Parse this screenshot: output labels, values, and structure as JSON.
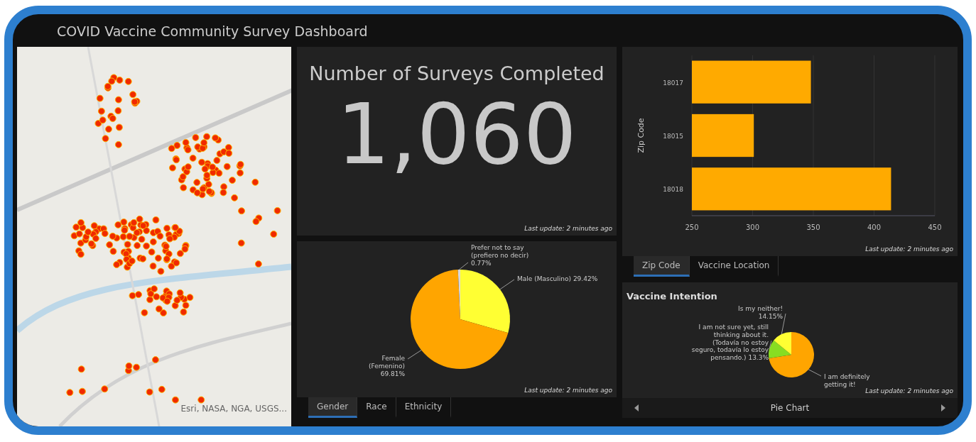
{
  "window": {
    "title": "COVID Vaccine Community Survey Dashboard"
  },
  "map": {
    "attribution": "Esri, NASA, NGA, USGS..."
  },
  "indicator": {
    "title": "Number of Surveys Completed",
    "value": "1,060",
    "last_update": "Last update: 2 minutes ago"
  },
  "gender_panel": {
    "chart_data": {
      "type": "pie",
      "categories": [
        "Male (Masculino)",
        "Female (Femenino)",
        "Prefer not to say (prefiero no decir)"
      ],
      "series": [
        {
          "values": [
            29.42,
            69.81,
            0.77
          ]
        }
      ],
      "value_labels": [
        "29.42%",
        "69.81%",
        "0.77%"
      ]
    },
    "last_update": "Last update: 2 minutes ago",
    "tabs": [
      {
        "label": "Gender",
        "selected": true
      },
      {
        "label": "Race",
        "selected": false
      },
      {
        "label": "Ethnicity",
        "selected": false
      }
    ]
  },
  "zip_panel": {
    "chart_data": {
      "type": "bar",
      "orientation": "horizontal",
      "ylabel": "Zip Code",
      "categories": [
        "18017",
        "18015",
        "18018"
      ],
      "series": [
        {
          "color": "#ffaa00",
          "values": [
            348,
            301,
            414
          ]
        }
      ],
      "grid": true,
      "xlim": [
        250,
        450
      ],
      "xticks": [
        250,
        300,
        350,
        400,
        450
      ]
    },
    "last_update": "Last update: 2 minutes ago",
    "tabs": [
      {
        "label": "Zip Code",
        "selected": true
      },
      {
        "label": "Vaccine Location",
        "selected": false
      }
    ]
  },
  "intention_panel": {
    "title": "Vaccine Intention",
    "chart_data": {
      "type": "pie",
      "categories": [
        "I am definitely getting it!",
        "I am not sure yet, still thinking about it. (Todavía no estoy seguro, todavía lo estoy pensando.)",
        "Is my neither!"
      ],
      "series": [
        {
          "values": [
            72.55,
            13.3,
            14.15
          ]
        }
      ],
      "value_labels": [
        null,
        "13.3%",
        "14.15%"
      ]
    },
    "last_update": "Last update: 2 minutes ago",
    "footer": {
      "label": "Pie Chart"
    }
  }
}
